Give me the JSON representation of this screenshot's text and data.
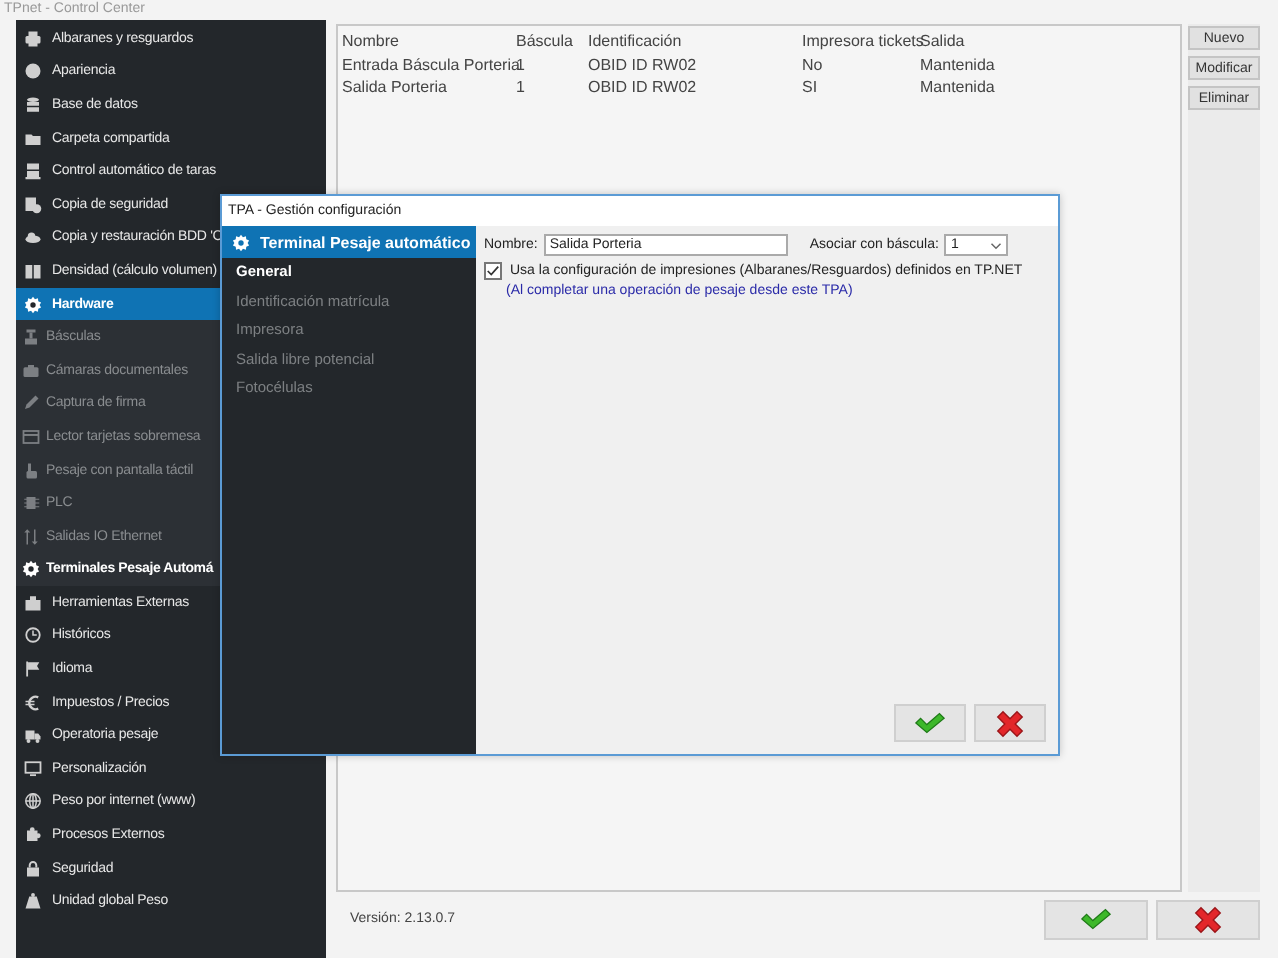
{
  "window": {
    "title": "TPnet - Control Center"
  },
  "sidebar": {
    "items": [
      {
        "label": "Albaranes y resguardos",
        "selected": false
      },
      {
        "label": "Apariencia",
        "selected": false
      },
      {
        "label": "Base de datos",
        "selected": false
      },
      {
        "label": "Carpeta compartida",
        "selected": false
      },
      {
        "label": "Control automático de taras",
        "selected": false
      },
      {
        "label": "Copia de seguridad",
        "selected": false
      },
      {
        "label": "Copia y restauración BDD 'C",
        "selected": false
      },
      {
        "label": "Densidad (cálculo volumen)",
        "selected": false
      },
      {
        "label": "Hardware",
        "selected": false,
        "expanded": true,
        "children": [
          {
            "label": "Básculas",
            "selected": false
          },
          {
            "label": "Cámaras documentales",
            "selected": false
          },
          {
            "label": "Captura de firma",
            "selected": false
          },
          {
            "label": "Lector tarjetas sobremesa",
            "selected": false
          },
          {
            "label": "Pesaje con pantalla táctil",
            "selected": false
          },
          {
            "label": "PLC",
            "selected": false
          },
          {
            "label": "Salidas IO Ethernet",
            "selected": false
          },
          {
            "label": "Terminales Pesaje Automá",
            "selected": true
          }
        ]
      },
      {
        "label": "Herramientas Externas",
        "selected": false
      },
      {
        "label": "Históricos",
        "selected": false
      },
      {
        "label": "Idioma",
        "selected": false
      },
      {
        "label": "Impuestos / Precios",
        "selected": false
      },
      {
        "label": "Operatoria pesaje",
        "selected": false
      },
      {
        "label": "Personalización",
        "selected": false
      },
      {
        "label": "Peso por internet (www)",
        "selected": false
      },
      {
        "label": "Procesos Externos",
        "selected": false
      },
      {
        "label": "Seguridad",
        "selected": false
      },
      {
        "label": "Unidad global Peso",
        "selected": false
      }
    ]
  },
  "table": {
    "columns": [
      "Nombre",
      "Báscula",
      "Identificación",
      "Impresora tickets",
      "Salida"
    ],
    "rows": [
      [
        "Entrada Báscula Porteria",
        "1",
        "OBID ID RW02",
        "No",
        "Mantenida"
      ],
      [
        "Salida Porteria",
        "1",
        "OBID ID RW02",
        "SI",
        "Mantenida"
      ]
    ]
  },
  "side_buttons": [
    "Nuevo",
    "Modificar",
    "Eliminar"
  ],
  "version": "Versión: 2.13.0.7",
  "dialog": {
    "title": "TPA - Gestión configuración",
    "header": "Terminal Pesaje automático",
    "nav": [
      {
        "label": "General",
        "selected": true
      },
      {
        "label": "Identificación matrícula",
        "selected": false
      },
      {
        "label": "Impresora",
        "selected": false
      },
      {
        "label": "Salida libre potencial",
        "selected": false
      },
      {
        "label": "Fotocélulas",
        "selected": false
      }
    ],
    "name_label": "Nombre:",
    "name_value": "Salida Porteria",
    "scale_label": "Asociar con báscula:",
    "scale_value": "1",
    "print_config": {
      "label": "Usa la configuración de impresiones (Albaranes/Resguardos) definidos en TP.NET",
      "checked": true
    },
    "note": "(Al completar una operación de pesaje desde este TPA)"
  }
}
